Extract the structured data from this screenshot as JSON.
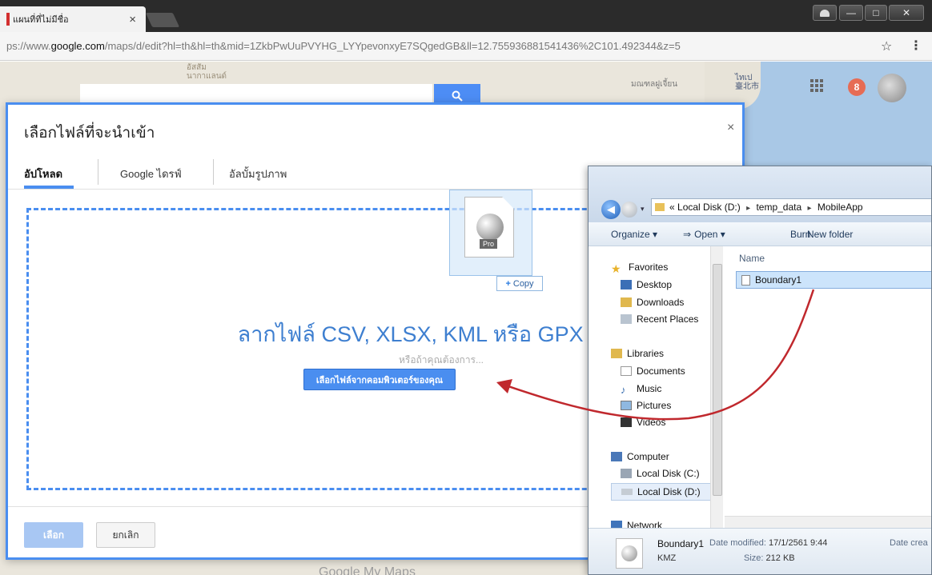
{
  "browser": {
    "tab_title": "แผนที่ที่ไม่มีชื่อ",
    "tab_close": "×",
    "url_prefix": "ps://www.",
    "url_host": "google.com",
    "url_rest": "/maps/d/edit?hl=th&hl=th&mid=1ZkbPwUuPVYHG_LYYpevonxyE7SQgedGB&ll=12.755936881541436%2C101.492344&z=5",
    "star": "☆",
    "menu": "⋮",
    "win_min": "—",
    "win_max": "□",
    "win_close": "✕"
  },
  "map": {
    "label_1": "อัสสัม",
    "label_1b": "นากาแลนด์",
    "label_2": "มณฑลฝูเจี้ยน",
    "label_3": "ไทเป",
    "label_3b": "臺北市",
    "search_icon": "search-icon",
    "notification_count": "8",
    "logo": "Google My Maps"
  },
  "dialog": {
    "title": "เลือกไฟล์ที่จะนำเข้า",
    "close": "×",
    "tabs": {
      "upload": "อัปโหลด",
      "drive": "Google ไดรฟ์",
      "album": "อัลบั้มรูปภาพ"
    },
    "drop_text": "ลากไฟล์ CSV, XLSX, KML หรือ GPX มาที่นี่",
    "or_text": "หรือถ้าคุณต้องการ...",
    "choose_button": "เลือกไฟล์จากคอมพิวเตอร์ของคุณ",
    "select_button": "เลือก",
    "cancel_button": "ยกเลิก"
  },
  "drag": {
    "badge_label": "Pro",
    "copy_plus": "+",
    "copy_label": "Copy"
  },
  "explorer": {
    "breadcrumb": [
      "Local Disk (D:)",
      "temp_data",
      "MobileApp"
    ],
    "breadcrumb_lead": "«",
    "breadcrumb_sep": "▸",
    "toolbar": {
      "organize": "Organize ▾",
      "open": "Open ▾",
      "burn": "Burn",
      "new_folder": "New folder"
    },
    "nav": {
      "favorites": "Favorites",
      "desktop": "Desktop",
      "downloads": "Downloads",
      "recent_places": "Recent Places",
      "libraries": "Libraries",
      "documents": "Documents",
      "music": "Music",
      "pictures": "Pictures",
      "videos": "Videos",
      "computer": "Computer",
      "local_disk_c": "Local Disk (C:)",
      "local_disk_d": "Local Disk (D:)",
      "network": "Network"
    },
    "column_name": "Name",
    "file_name": "Boundary1",
    "details": {
      "name": "Boundary1",
      "type": "KMZ",
      "date_modified_label": "Date modified:",
      "date_modified": "17/1/2561 9:44",
      "size_label": "Size:",
      "size": "212 KB",
      "date_created_label": "Date crea"
    }
  },
  "colors": {
    "accent": "#4a8ef0",
    "arrow": "#c0282d"
  }
}
